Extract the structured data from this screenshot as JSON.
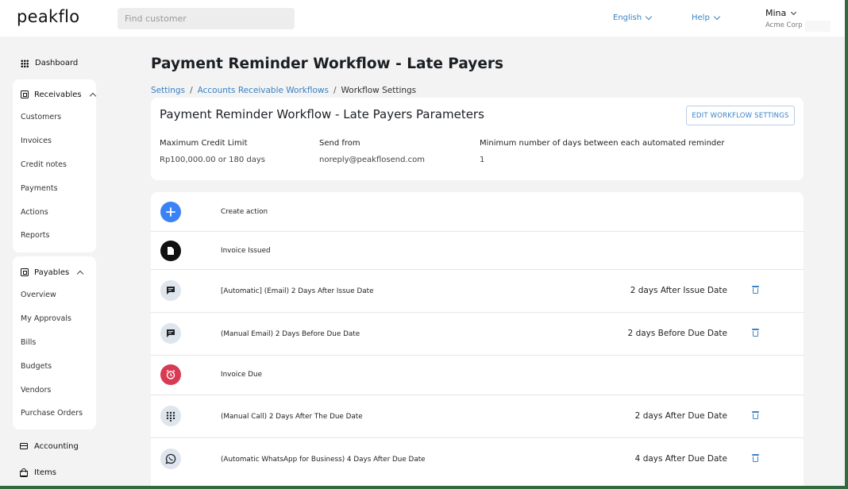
{
  "header": {
    "logo": "peakflo",
    "search_placeholder": "Find customer",
    "language": "English",
    "help": "Help",
    "user_name": "Mina",
    "user_org": "Acme Corp"
  },
  "sidebar": {
    "dashboard": "Dashboard",
    "receivables": {
      "title": "Receivables",
      "items": [
        "Customers",
        "Invoices",
        "Credit notes",
        "Payments",
        "Actions",
        "Reports"
      ]
    },
    "payables": {
      "title": "Payables",
      "items": [
        "Overview",
        "My Approvals",
        "Bills",
        "Budgets",
        "Vendors",
        "Purchase Orders"
      ]
    },
    "accounting": "Accounting",
    "items": "Items"
  },
  "main": {
    "title": "Payment Reminder Workflow - Late Payers",
    "breadcrumb": {
      "settings": "Settings",
      "workflows": "Accounts Receivable Workflows",
      "current": "Workflow Settings",
      "separator": "/"
    },
    "params": {
      "title": "Payment Reminder Workflow - Late Payers Parameters",
      "edit_button": "EDIT WORKFLOW SETTINGS",
      "credit_label": "Maximum Credit Limit",
      "credit_value": "Rp100,000.00 or 180 days",
      "send_label": "Send from",
      "send_value": "noreply@peakflosend.com",
      "min_days_label": "Minimum number of days between each automated reminder",
      "min_days_value": "1"
    },
    "steps": [
      {
        "label": "Create action",
        "icon": "plus-icon",
        "timing": ""
      },
      {
        "label": "Invoice Issued",
        "icon": "document-icon",
        "timing": ""
      },
      {
        "label": "[Automatic] (Email) 2 Days After Issue Date",
        "icon": "chat-icon",
        "timing": "2 days After Issue Date"
      },
      {
        "label": "(Manual Email) 2 Days Before Due Date",
        "icon": "chat-icon",
        "timing": "2 days Before Due Date"
      },
      {
        "label": "Invoice Due",
        "icon": "alarm-clock-icon",
        "timing": ""
      },
      {
        "label": "(Manual Call) 2 Days After The Due Date",
        "icon": "dialpad-icon",
        "timing": "2 days After Due Date"
      },
      {
        "label": "(Automatic WhatsApp for Business) 4 Days After Due Date",
        "icon": "whatsapp-icon",
        "timing": "4 days After Due Date"
      }
    ]
  },
  "colors": {
    "accent": "#3b82c4",
    "create_action": "#3b82f6",
    "invoice_due": "#d83a53",
    "outer_border": "#2f6b3e"
  }
}
